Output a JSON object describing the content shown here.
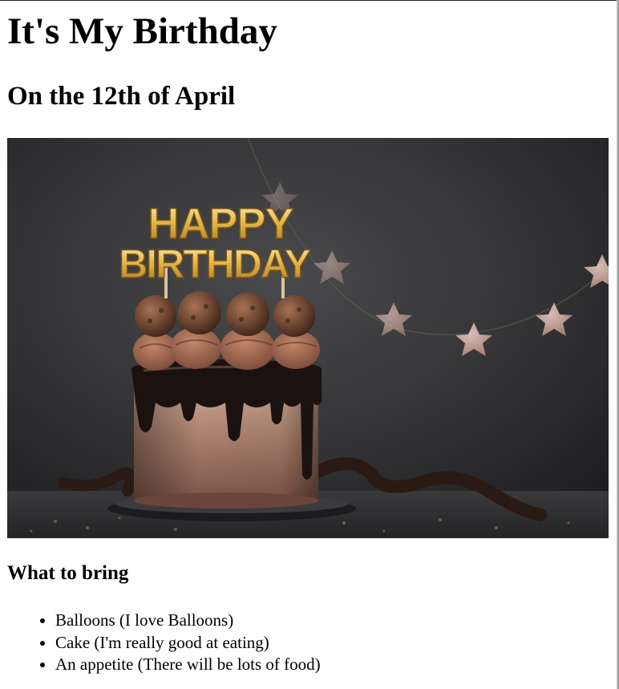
{
  "page": {
    "title": "It's My Birthday",
    "subtitle": "On the 12th of April"
  },
  "hero_image": {
    "topper_line_1": "HAPPY",
    "topper_line_2": "BIRTHDAY"
  },
  "bring_section": {
    "heading": "What to bring",
    "items": [
      "Balloons (I love Balloons)",
      "Cake (I'm really good at eating)",
      "An appetite (There will be lots of food)"
    ]
  },
  "colors": {
    "text": "#000000",
    "background": "#ffffff",
    "chocolate": "#6b4032",
    "gold_topper": "#e6b84a",
    "backdrop": "#2e2e2f"
  }
}
